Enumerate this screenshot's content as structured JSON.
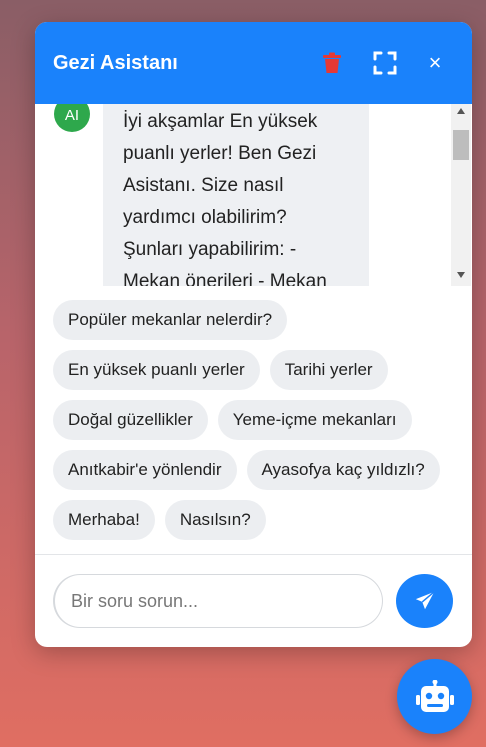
{
  "header": {
    "title": "Gezi Asistanı",
    "trash_icon": "trash-icon",
    "expand_icon": "expand-icon",
    "close_label": "×"
  },
  "message": {
    "avatar_label": "AI",
    "text": "İyi akşamlar En yüksek puanlı yerler! Ben Gezi Asistanı. Size nasıl yardımcı olabilirim? Şunları yapabilirim: - Mekan önerileri - Mekan"
  },
  "suggestions": [
    [
      "Popüler mekanlar nelerdir?"
    ],
    [
      "En yüksek puanlı yerler",
      "Tarihi yerler"
    ],
    [
      "Doğal güzellikler",
      "Yeme-içme mekanları"
    ],
    [
      "Anıtkabir'e yönlendir",
      "Ayasofya kaç yıldızlı?"
    ],
    [
      "Merhaba!",
      "Nasılsın?"
    ]
  ],
  "input": {
    "placeholder": "Bir soru sorun...",
    "value": ""
  },
  "colors": {
    "accent": "#1a82fb",
    "avatar": "#2ea84c",
    "trash": "#e53935"
  },
  "fab_icon": "robot-icon"
}
